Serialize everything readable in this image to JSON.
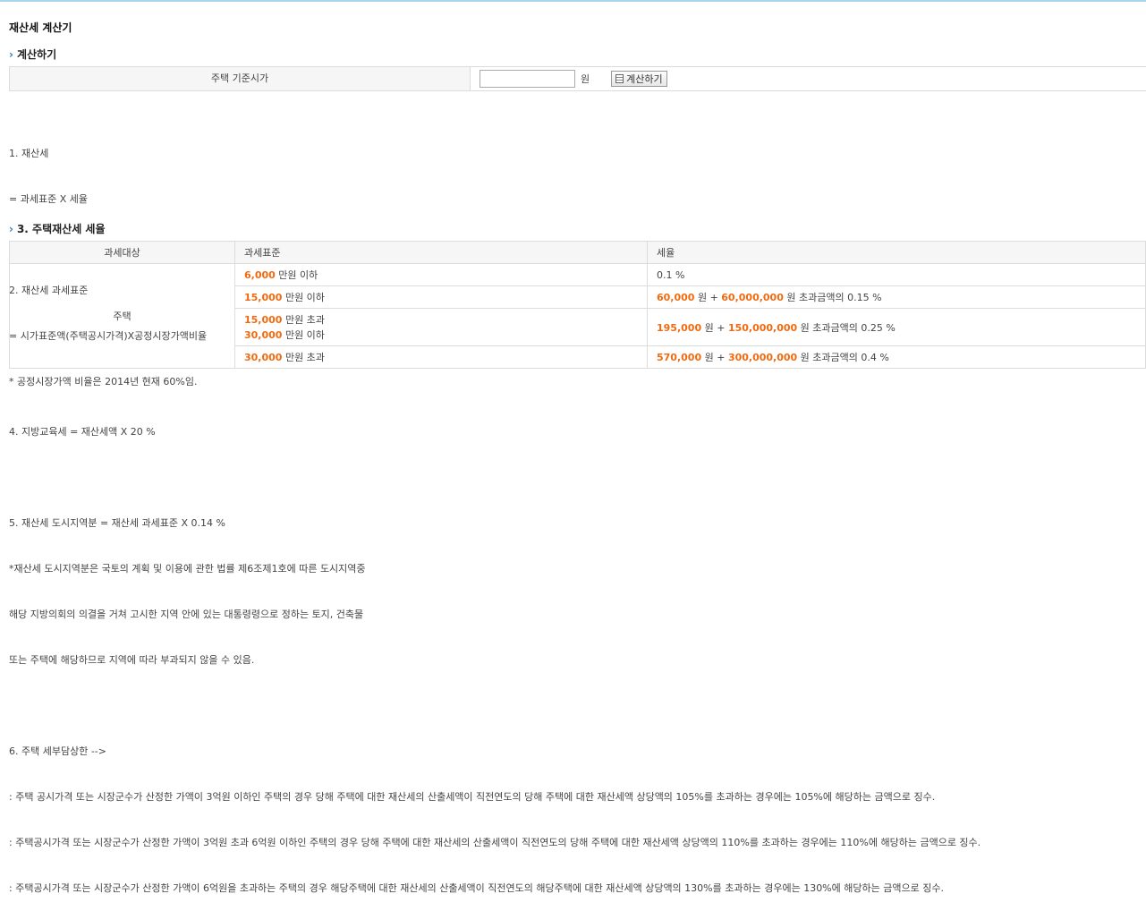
{
  "page_title": "재산세 계산기",
  "section1": {
    "arrow": "›",
    "title": "계산하기"
  },
  "calc": {
    "label": "주택 기준시가",
    "input_value": "",
    "unit": "원",
    "button_label": "계산하기",
    "button_icon": "calculator-icon"
  },
  "notes1": {
    "line1": "1. 재산세",
    "line2": "= 과세표준 X 세율",
    "line3": "2. 재산세 과세표준",
    "line4": "= 시가표준액(주택공시가격)X공정시장가액비율",
    "line5": "* 공정시장가액 비율은 2014년 현재 60%임."
  },
  "section3": {
    "arrow": "›",
    "title": "3. 주택재산세 세율"
  },
  "table": {
    "headers": [
      "과세대상",
      "과세표준",
      "세율"
    ],
    "subject": "주택",
    "rows": [
      {
        "std": [
          {
            "num": "6,000",
            "txt": " 만원 이하"
          }
        ],
        "rate": [
          {
            "txt": "0.1 %"
          }
        ]
      },
      {
        "std": [
          {
            "num": "15,000",
            "txt": " 만원 이하"
          }
        ],
        "rate": [
          {
            "num": "60,000",
            "txt": " 원 + "
          },
          {
            "num": "60,000,000",
            "txt": " 원 초과금액의 0.15 %"
          }
        ]
      },
      {
        "std": [
          {
            "num": "15,000",
            "txt": " 만원 초과"
          },
          {
            "num": "30,000",
            "txt": " 만원 이하"
          }
        ],
        "rate": [
          {
            "num": "195,000",
            "txt": " 원 + "
          },
          {
            "num": "150,000,000",
            "txt": " 원 초과금액의 0.25 %"
          }
        ]
      },
      {
        "std": [
          {
            "num": "30,000",
            "txt": " 만원 초과"
          }
        ],
        "rate": [
          {
            "num": "570,000",
            "txt": " 원 + "
          },
          {
            "num": "300,000,000",
            "txt": " 원 초과금액의 0.4 %"
          }
        ]
      }
    ]
  },
  "notes2": {
    "line1": "4. 지방교육세 = 재산세액 X 20 %",
    "line2": "5. 재산세 도시지역분 = 재산세 과세표준 X 0.14 %",
    "line3": "*재산세 도시지역분은 국토의 계획 및 이용에 관한 법률 제6조제1호에 따른 도시지역중",
    "line4": "해당 지방의회의 의결을 거쳐 고시한 지역 안에 있는 대통령령으로 정하는 토지, 건축물",
    "line5": "또는 주택에 해당하므로 지역에 따라 부과되지 않을 수 있음.",
    "line6": "6. 주택 세부담상한 -->",
    "line7": ": 주택 공시가격 또는 시장군수가 산정한 가액이 3억원 이하인 주택의 경우 당해 주택에 대한 재산세의 산출세액이 직전연도의 당해 주택에 대한 재산세액 상당액의 105%를 초과하는 경우에는 105%에 해당하는 금액으로 징수.",
    "line8": ": 주택공시가격 또는 시장군수가 산정한 가액이 3억원 초과 6억원 이하인 주택의 경우 당해 주택에 대한 재산세의 산출세액이 직전연도의 당해 주택에 대한 재산세액 상당액의 110%를 초과하는 경우에는 110%에 해당하는 금액으로 징수.",
    "line9": ": 주택공시가격 또는 시장군수가 산정한 가액이 6억원을 초과하는 주택의 경우 해당주택에 대한 재산세의 산출세액이 직전연도의 해당주택에 대한 재산세액 상당액의 130%를 초과하는 경우에는 130%에 해당하는 금액으로 징수."
  }
}
